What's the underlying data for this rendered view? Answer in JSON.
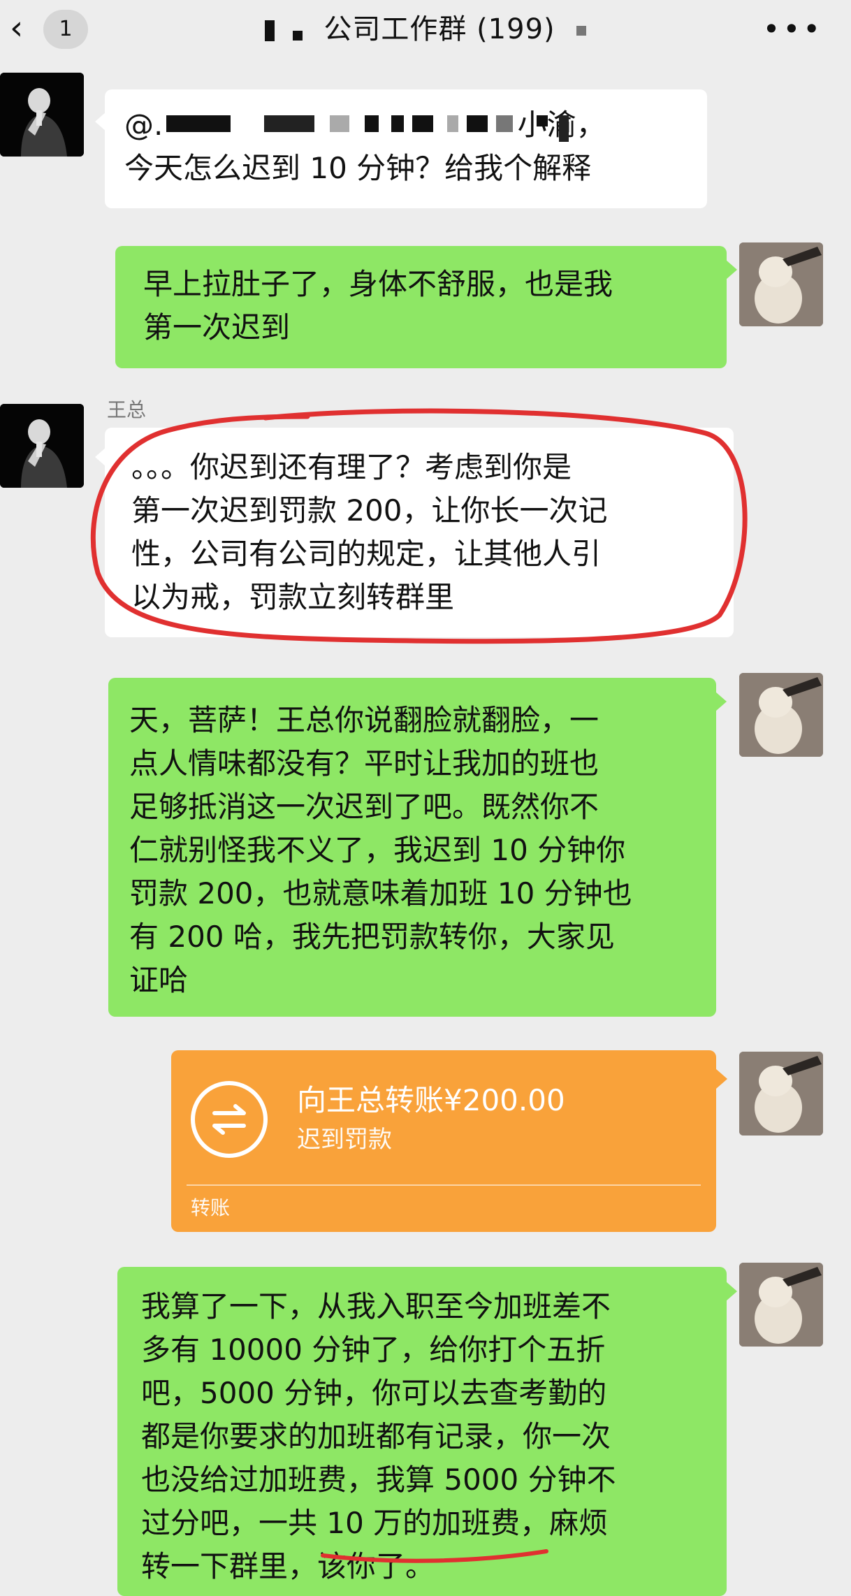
{
  "header": {
    "back_badge": "1",
    "title": "公司工作群 (199)"
  },
  "messages": {
    "m1": "@.                                      小渝，\n今天怎么迟到 10 分钟？给我个解释",
    "m2": "早上拉肚子了，身体不舒服，也是我\n第一次迟到",
    "m3_sender": "王总",
    "m3": "。。。你迟到还有理了？考虑到你是\n第一次迟到罚款 200，让你长一次记\n性，公司有公司的规定，让其他人引\n以为戒，罚款立刻转群里",
    "m4": "天，菩萨！王总你说翻脸就翻脸，一\n点人情味都没有？平时让我加的班也\n足够抵消这一次迟到了吧。既然你不\n仁就别怪我不义了，我迟到 10 分钟你\n罚款 200，也就意味着加班 10 分钟也\n有 200 哈，我先把罚款转你，大家见\n证哈",
    "transfer": {
      "amount": "向王总转账¥200.00",
      "note": "迟到罚款",
      "kind": "转账"
    },
    "m6": "我算了一下，从我入职至今加班差不\n多有 10000 分钟了，给你打个五折\n吧，5000 分钟，你可以去查考勤的\n都是你要求的加班都有记录，你一次\n也没给过加班费，我算 5000 分钟不\n过分吧，一共 10 万的加班费，麻烦\n转一下群里，该你了。"
  },
  "colors": {
    "background": "#ededed",
    "bubble_self": "#8ee765",
    "bubble_other": "#ffffff",
    "transfer": "#f9a23a",
    "annotation": "#e03030"
  }
}
